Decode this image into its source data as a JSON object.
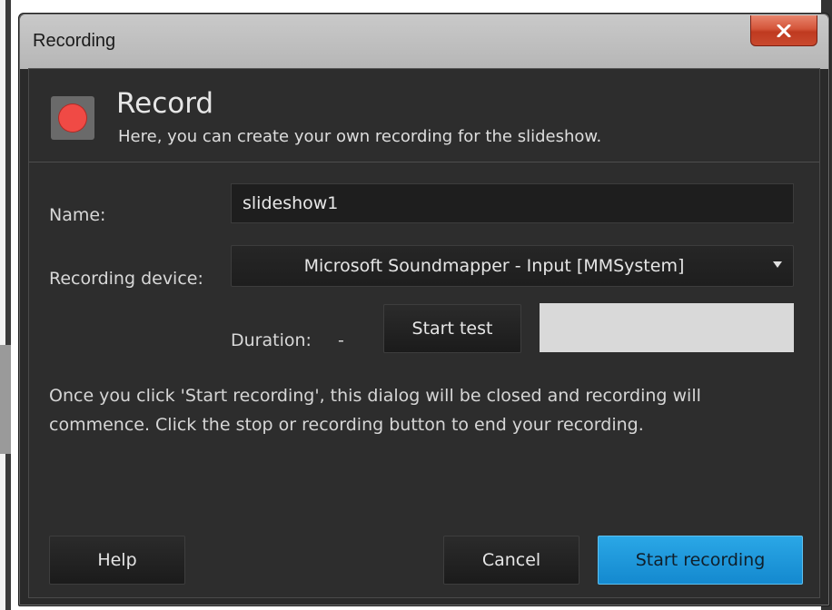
{
  "window": {
    "title": "Recording",
    "close_glyph": "X"
  },
  "header": {
    "icon": "record-icon",
    "title": "Record",
    "subtitle": "Here, you can create your own recording for the slideshow."
  },
  "form": {
    "name_label": "Name:",
    "name_value": "slideshow1",
    "device_label": "Recording device:",
    "device_value": "Microsoft Soundmapper - Input [MMSystem]",
    "duration_label": "Duration:",
    "duration_value": "-",
    "start_test_label": "Start test"
  },
  "info_text": "Once you click 'Start recording', this dialog will be closed and recording will commence. Click the stop or recording button to end your recording.",
  "buttons": {
    "help": "Help",
    "cancel": "Cancel",
    "start_recording": "Start recording"
  },
  "colors": {
    "accent": "#1e96dc",
    "record_dot": "#f04a45",
    "close_button": "#c94a30"
  }
}
